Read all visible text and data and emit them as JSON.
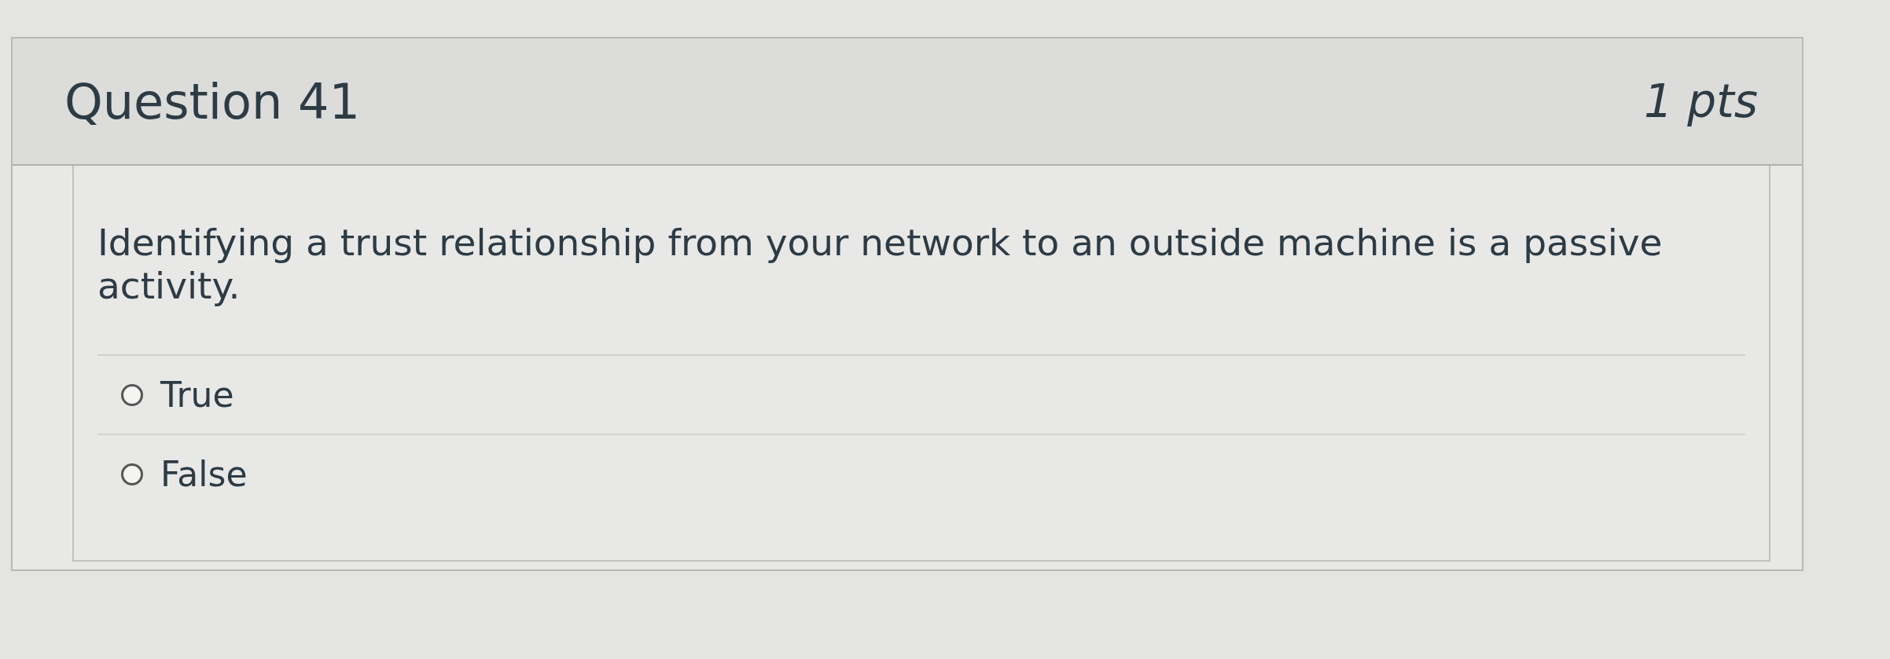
{
  "question": {
    "title": "Question 41",
    "points": "1 pts",
    "text": "Identifying a trust relationship from your network to an outside machine is a passive activity.",
    "answers": [
      {
        "label": "True",
        "selected": false
      },
      {
        "label": "False",
        "selected": false
      }
    ]
  }
}
